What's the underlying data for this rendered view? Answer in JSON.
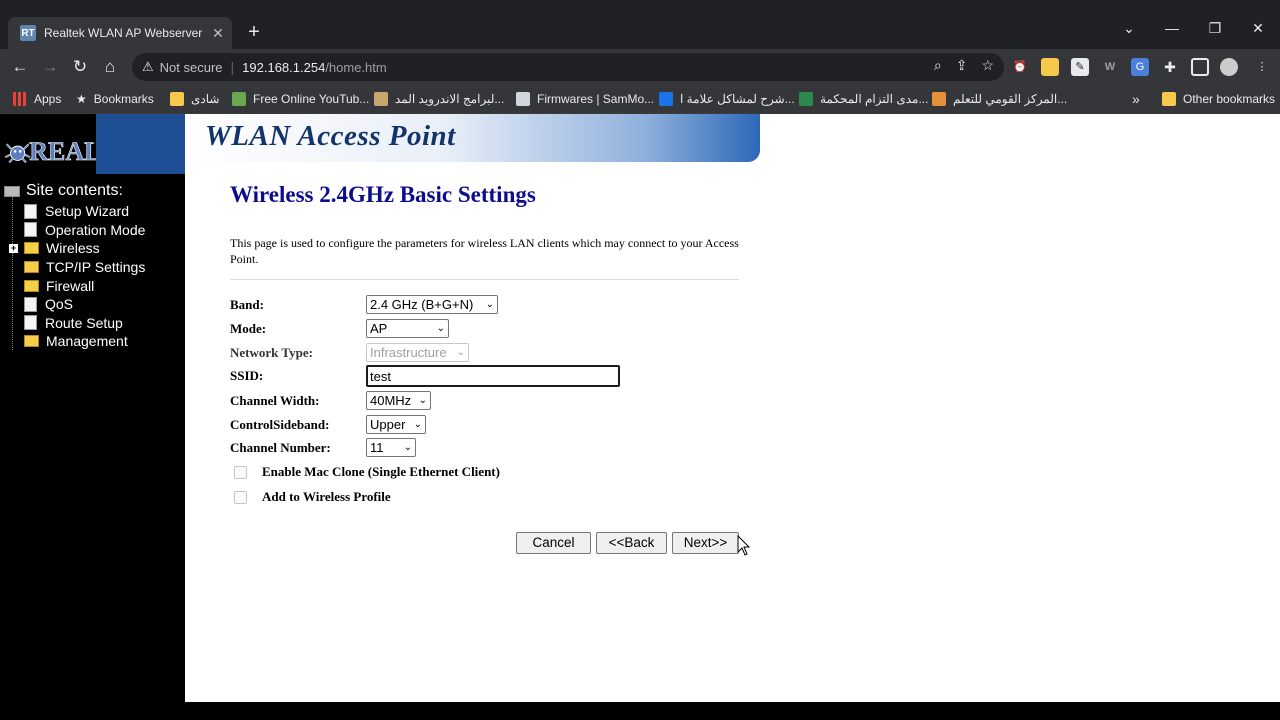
{
  "browser": {
    "tab_title": "Realtek WLAN AP Webserver",
    "tab_favicon": "RT",
    "new_tab": "+",
    "url_security": "Not secure",
    "url_host": "192.168.1.254",
    "url_path": "/home.htm",
    "bookmarks": [
      {
        "label": "Apps",
        "icon": "apps-grid-icon"
      },
      {
        "label": "Bookmarks",
        "icon": "star-icon"
      },
      {
        "label": "شادى",
        "icon": "folder-icon"
      },
      {
        "label": "Free Online YouTub...",
        "icon": "download-arrow-icon"
      },
      {
        "label": "لبرامج الاندرويد المد...",
        "icon": "site-icon"
      },
      {
        "label": "Firmwares | SamMo...",
        "icon": "site-icon"
      },
      {
        "label": "شرح لمشاكل علامة ا...",
        "icon": "r-logo-icon"
      },
      {
        "label": "مدى التزام المحكمة...",
        "icon": "site-icon"
      },
      {
        "label": "المركز القومي للتعلم...",
        "icon": "site-icon"
      },
      {
        "label": "Other bookmarks",
        "icon": "folder-icon"
      }
    ],
    "overflow": "»"
  },
  "banner": {
    "logo_text": "REALTEK",
    "title": "WLAN Access Point"
  },
  "sidebar": {
    "root": "Site contents:",
    "items": [
      {
        "label": "Setup Wizard",
        "type": "page"
      },
      {
        "label": "Operation Mode",
        "type": "page"
      },
      {
        "label": "Wireless",
        "type": "folder",
        "expandable": true
      },
      {
        "label": "TCP/IP Settings",
        "type": "folder"
      },
      {
        "label": "Firewall",
        "type": "folder"
      },
      {
        "label": "QoS",
        "type": "page"
      },
      {
        "label": "Route Setup",
        "type": "page"
      },
      {
        "label": "Management",
        "type": "folder"
      }
    ]
  },
  "main": {
    "title": "Wireless 2.4GHz Basic Settings",
    "description": "This page is used to configure the parameters for wireless LAN clients which may connect to your Access Point.",
    "fields": {
      "band": {
        "label": "Band:",
        "value": "2.4 GHz (B+G+N)"
      },
      "mode": {
        "label": "Mode:",
        "value": "AP"
      },
      "network_type": {
        "label": "Network Type:",
        "value": "Infrastructure",
        "disabled": true
      },
      "ssid": {
        "label": "SSID:",
        "value": "test"
      },
      "channel_width": {
        "label": "Channel Width:",
        "value": "40MHz"
      },
      "control_sideband": {
        "label": "ControlSideband:",
        "value": "Upper"
      },
      "channel_number": {
        "label": "Channel Number:",
        "value": "11"
      }
    },
    "checkboxes": {
      "mac_clone": {
        "label": "Enable Mac Clone (Single Ethernet Client)",
        "checked": false
      },
      "wireless_profile": {
        "label": "Add to Wireless Profile",
        "checked": false
      }
    },
    "buttons": {
      "cancel": "Cancel",
      "back": "<<Back",
      "next": "Next>>"
    }
  }
}
